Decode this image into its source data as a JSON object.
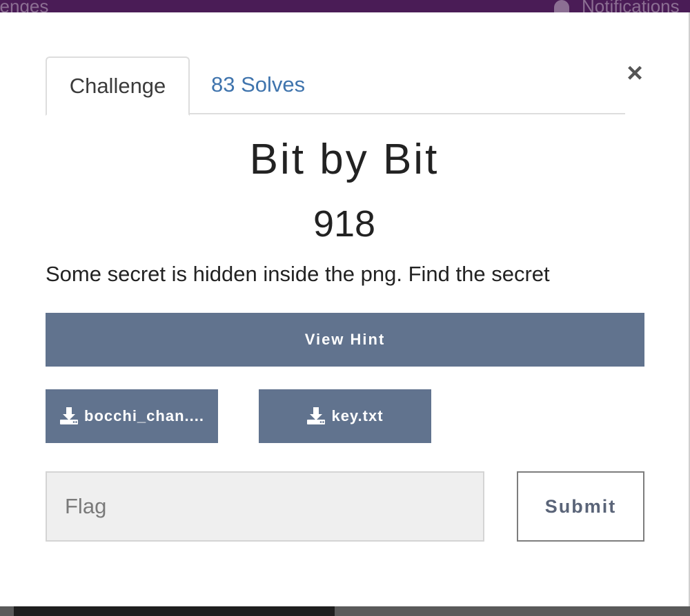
{
  "background": {
    "nav_left_text": "llenges",
    "nav_right_text": "Notifications"
  },
  "modal": {
    "tabs": [
      {
        "label": "Challenge",
        "active": true
      },
      {
        "label": "83 Solves",
        "active": false
      }
    ],
    "close_glyph": "×",
    "title": "Bit by Bit",
    "points": "918",
    "description": "Some secret is hidden inside the png. Find the secret",
    "hint_button": "View Hint",
    "files": [
      {
        "label": "bocchi_chan....",
        "icon": "download-icon"
      },
      {
        "label": "key.txt",
        "icon": "download-icon"
      }
    ],
    "flag_placeholder": "Flag",
    "submit_label": "Submit"
  },
  "colors": {
    "nav": "#4a1c56",
    "button": "#61738e",
    "link": "#3f74ad"
  }
}
